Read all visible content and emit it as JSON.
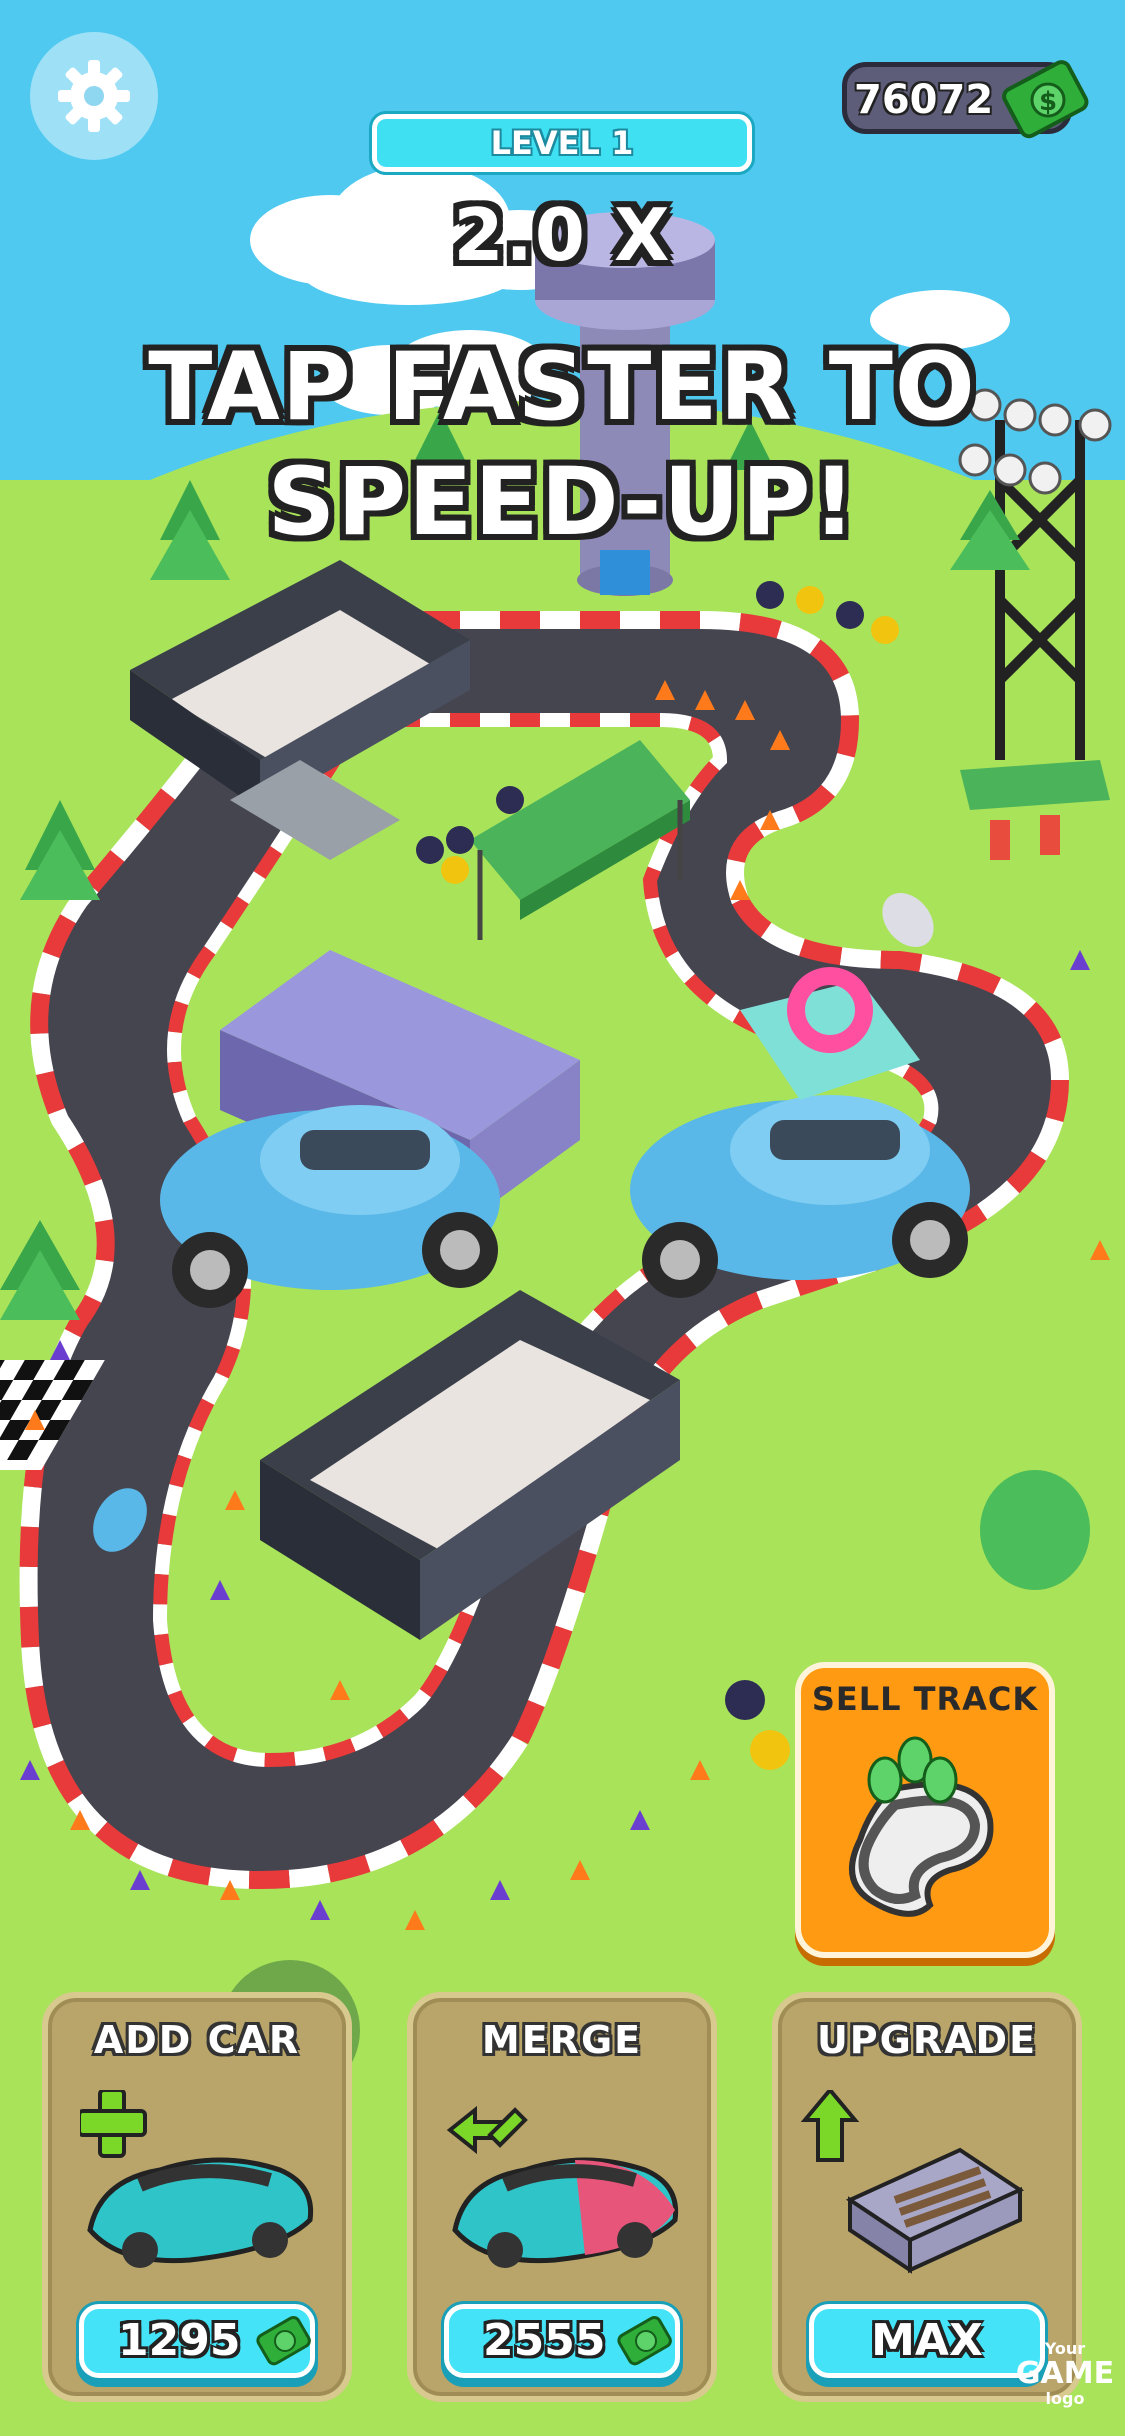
{
  "hud": {
    "coins": "76072",
    "level": "LEVEL 1",
    "multiplier": "2.0 X",
    "headline_line1": "TAP FASTER TO",
    "headline_line2": "SPEED-UP!"
  },
  "sell_track": {
    "label": "SELL TRACK"
  },
  "panels": [
    {
      "title": "ADD CAR",
      "price": "1295"
    },
    {
      "title": "MERGE",
      "price": "2555"
    },
    {
      "title": "UPGRADE",
      "price": "MAX"
    }
  ],
  "watermark": {
    "line1": "Your",
    "line2": "GAME",
    "line3": "logo"
  },
  "colors": {
    "sky": "#4fc9f0",
    "grass": "#a8e35a",
    "track": "#454550",
    "curb_red": "#e83a3a",
    "accent_cyan": "#44e3f7",
    "sell_orange": "#ff9a12",
    "panel_tan": "#b9a56a",
    "car_blue": "#5ab8e8"
  },
  "icons": [
    "gear-icon",
    "dollar-bill-icon",
    "plus-icon",
    "merge-arrows-icon",
    "arrow-up-icon",
    "track-icon"
  ]
}
